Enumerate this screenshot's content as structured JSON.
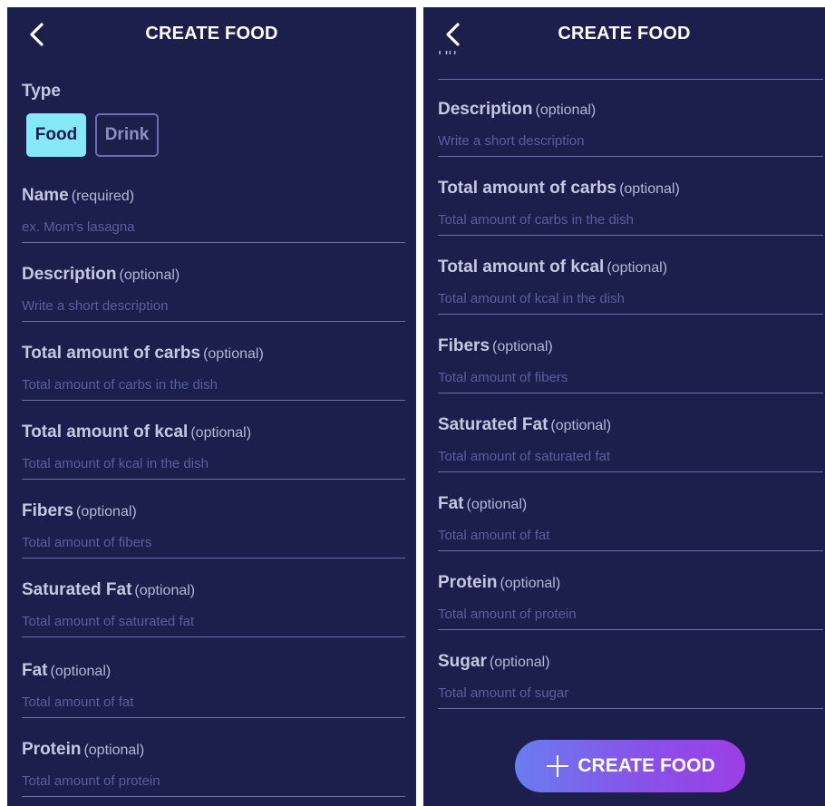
{
  "colors": {
    "background": "#1c1f4b",
    "accent": "#84e8f8",
    "label": "#c5c8e3",
    "placeholder": "#5a5e9a",
    "divider": "#6a6ea6",
    "button_gradient_start": "#6a7cf0",
    "button_gradient_end": "#9b3fe6"
  },
  "left": {
    "header": {
      "title": "CREATE FOOD",
      "back_icon": "chevron-left-icon"
    },
    "type": {
      "label": "Type",
      "options": [
        "Food",
        "Drink"
      ],
      "selected": "Food"
    },
    "fields": [
      {
        "label": "Name",
        "hint": "(required)",
        "placeholder": "ex. Mom's lasagna"
      },
      {
        "label": "Description",
        "hint": "(optional)",
        "placeholder": "Write a short description"
      },
      {
        "label": "Total amount of carbs",
        "hint": "(optional)",
        "placeholder": "Total amount of carbs in the dish"
      },
      {
        "label": "Total amount of kcal",
        "hint": "(optional)",
        "placeholder": "Total amount of kcal in the dish"
      },
      {
        "label": "Fibers",
        "hint": "(optional)",
        "placeholder": "Total amount of fibers"
      },
      {
        "label": "Saturated Fat",
        "hint": "(optional)",
        "placeholder": "Total amount of saturated fat"
      },
      {
        "label": "Fat",
        "hint": "(optional)",
        "placeholder": "Total amount of fat"
      },
      {
        "label": "Protein",
        "hint": "(optional)",
        "placeholder": "Total amount of protein"
      }
    ]
  },
  "right": {
    "header": {
      "title": "CREATE FOOD",
      "back_icon": "chevron-left-icon"
    },
    "partial_value": "Hh",
    "fields": [
      {
        "label": "Description",
        "hint": "(optional)",
        "placeholder": "Write a short description"
      },
      {
        "label": "Total amount of carbs",
        "hint": "(optional)",
        "placeholder": "Total amount of carbs in the dish"
      },
      {
        "label": "Total amount of kcal",
        "hint": "(optional)",
        "placeholder": "Total amount of kcal in the dish"
      },
      {
        "label": "Fibers",
        "hint": "(optional)",
        "placeholder": "Total amount of fibers"
      },
      {
        "label": "Saturated Fat",
        "hint": "(optional)",
        "placeholder": "Total amount of saturated fat"
      },
      {
        "label": "Fat",
        "hint": "(optional)",
        "placeholder": "Total amount of fat"
      },
      {
        "label": "Protein",
        "hint": "(optional)",
        "placeholder": "Total amount of protein"
      },
      {
        "label": "Sugar",
        "hint": "(optional)",
        "placeholder": "Total amount of sugar"
      }
    ],
    "create_button": {
      "label": "CREATE FOOD",
      "icon": "plus-icon"
    }
  }
}
